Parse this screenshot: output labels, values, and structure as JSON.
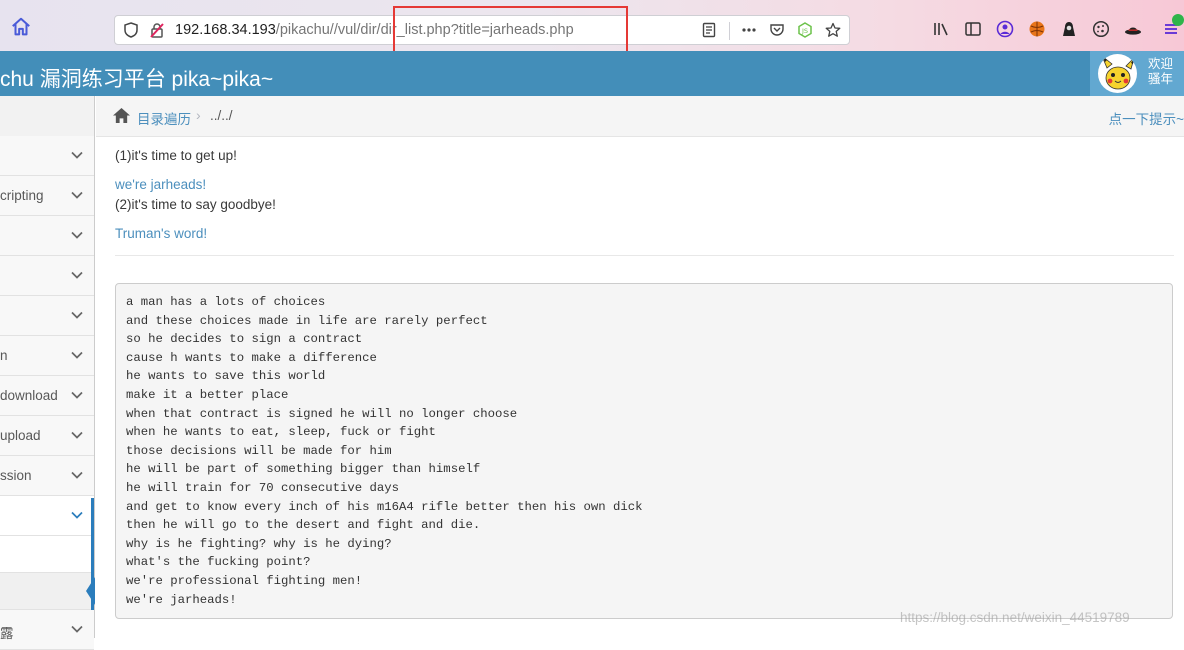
{
  "browser": {
    "url_host": "192.168.34.193",
    "url_path": "/pikachu//vul/dir/dir_list.php?title=jarheads.php"
  },
  "header": {
    "title": "chu 漏洞练习平台 pika~pika~",
    "welcome_line1": "欢迎",
    "welcome_line2": "骚年"
  },
  "sidebar": {
    "items": [
      {
        "label": ""
      },
      {
        "label": "cripting"
      },
      {
        "label": ""
      },
      {
        "label": ""
      },
      {
        "label": ""
      },
      {
        "label": "n"
      },
      {
        "label": "download"
      },
      {
        "label": "upload"
      },
      {
        "label": "ssion"
      },
      {
        "label": ""
      },
      {
        "label": "露"
      }
    ]
  },
  "breadcrumb": {
    "section": "目录遍历",
    "separator": "›",
    "current": "../../",
    "hint": "点一下提示~"
  },
  "content": {
    "line1": "(1)it's time to get up!",
    "link1": "we're jarheads!",
    "line2": "(2)it's time to say goodbye!",
    "link2": "Truman's word!",
    "poem": [
      "a man has a lots of choices",
      "and these choices made in life are rarely perfect",
      "so he decides to sign a contract",
      "cause h wants to make a difference",
      "he wants to save this world",
      "make it a better place",
      "when that contract is signed he will no longer choose",
      "when he wants to eat, sleep, fuck or fight",
      "those decisions will be made for him",
      "he will be part of something bigger than himself",
      "he will train for 70 consecutive days",
      "and get to know every inch of his m16A4 rifle better then his own dick",
      "then he will go to the desert and fight and die.",
      "why is he fighting? why is he dying?",
      "what's the fucking point?",
      "we're professional fighting men!",
      "we're jarheads!"
    ]
  },
  "watermark": "https://blog.csdn.net/weixin_44519789",
  "colors": {
    "header_bg": "#438eb9",
    "link": "#4c8fbd",
    "highlight_box": "#e53935"
  }
}
